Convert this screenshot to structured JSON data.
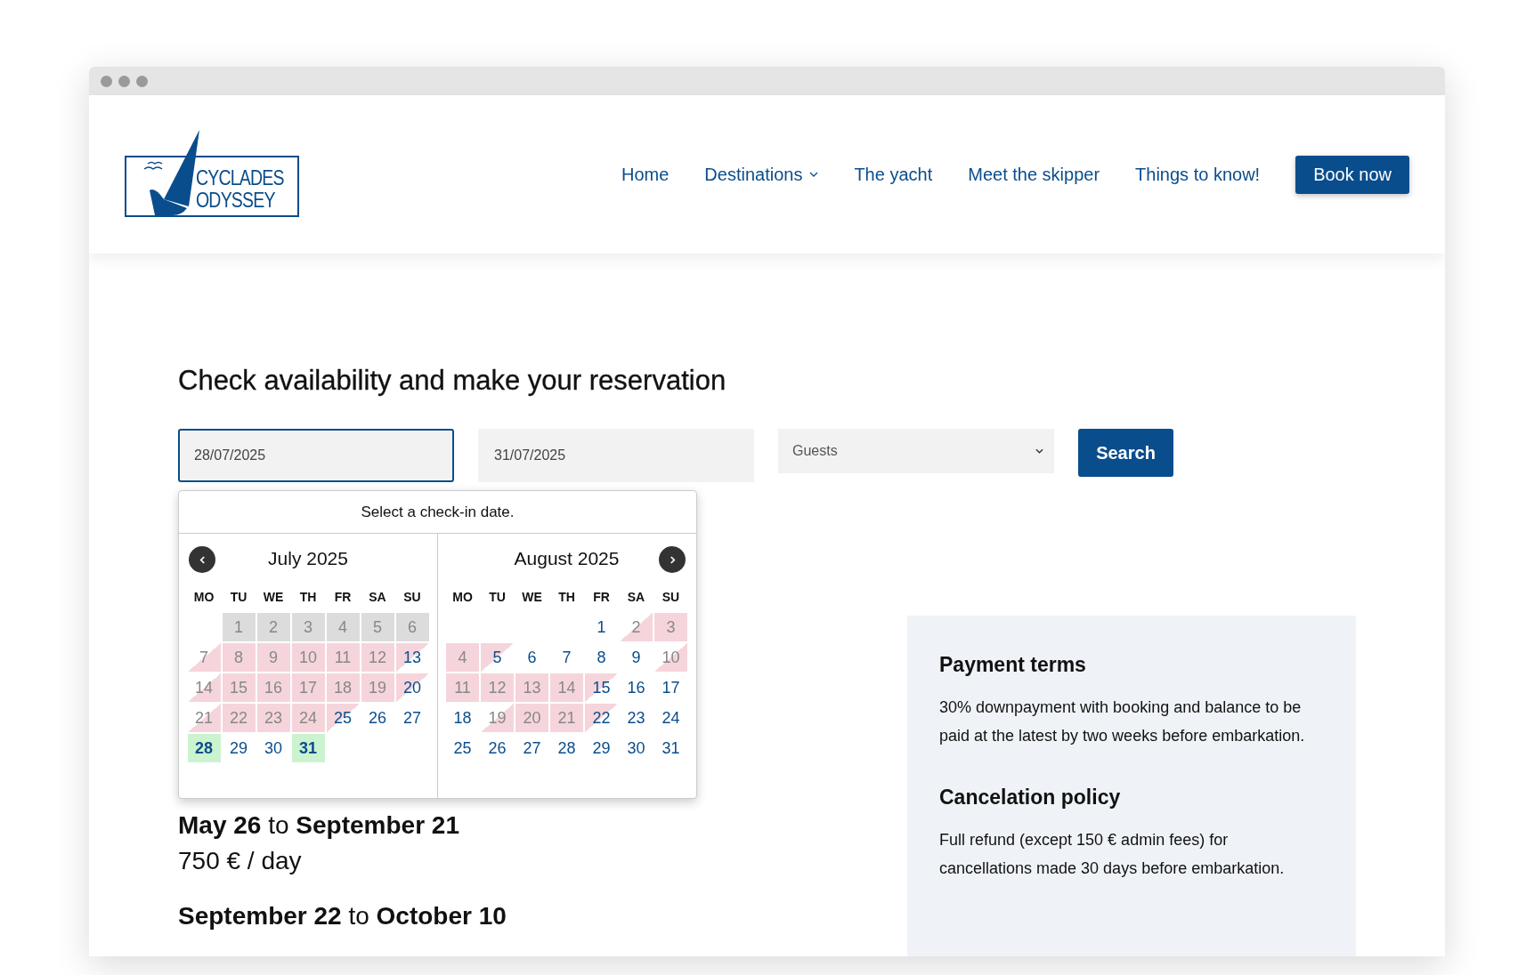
{
  "logo": {
    "line_1": "CYCLADES",
    "line_2": "ODYSSEY"
  },
  "nav": [
    {
      "label": "Home",
      "dropdown": false
    },
    {
      "label": "Destinations",
      "dropdown": true
    },
    {
      "label": "The yacht",
      "dropdown": false
    },
    {
      "label": "Meet the skipper",
      "dropdown": false
    },
    {
      "label": "Things to know!",
      "dropdown": false
    }
  ],
  "book_button": "Book now",
  "heading": "Check availability and make your reservation",
  "checkin": {
    "value": "28/07/2025",
    "focused": true
  },
  "checkout": {
    "value": "31/07/2025",
    "focused": false
  },
  "guests": {
    "placeholder": "Guests"
  },
  "search_button": "Search",
  "datepicker": {
    "prompt": "Select a check-in date.",
    "months": [
      {
        "title": "July 2025",
        "weekdays": [
          "MO",
          "TU",
          "WE",
          "TH",
          "FR",
          "SA",
          "SU"
        ],
        "days": [
          {
            "kind": "empty"
          },
          {
            "day": "1",
            "kind": "past"
          },
          {
            "day": "2",
            "kind": "past"
          },
          {
            "day": "3",
            "kind": "past"
          },
          {
            "day": "4",
            "kind": "past"
          },
          {
            "day": "5",
            "kind": "past"
          },
          {
            "day": "6",
            "kind": "past"
          },
          {
            "day": "7",
            "kind": "pm"
          },
          {
            "day": "8",
            "kind": "booked"
          },
          {
            "day": "9",
            "kind": "booked"
          },
          {
            "day": "10",
            "kind": "booked"
          },
          {
            "day": "11",
            "kind": "booked"
          },
          {
            "day": "12",
            "kind": "booked"
          },
          {
            "day": "13",
            "kind": "am"
          },
          {
            "day": "14",
            "kind": "pm"
          },
          {
            "day": "15",
            "kind": "booked"
          },
          {
            "day": "16",
            "kind": "booked"
          },
          {
            "day": "17",
            "kind": "booked"
          },
          {
            "day": "18",
            "kind": "booked"
          },
          {
            "day": "19",
            "kind": "booked"
          },
          {
            "day": "20",
            "kind": "am"
          },
          {
            "day": "21",
            "kind": "pm"
          },
          {
            "day": "22",
            "kind": "booked"
          },
          {
            "day": "23",
            "kind": "booked"
          },
          {
            "day": "24",
            "kind": "booked"
          },
          {
            "day": "25",
            "kind": "am"
          },
          {
            "day": "26",
            "kind": "free"
          },
          {
            "day": "27",
            "kind": "free"
          },
          {
            "day": "28",
            "kind": "selected"
          },
          {
            "day": "29",
            "kind": "free"
          },
          {
            "day": "30",
            "kind": "free"
          },
          {
            "day": "31",
            "kind": "selected"
          }
        ]
      },
      {
        "title": "August 2025",
        "weekdays": [
          "MO",
          "TU",
          "WE",
          "TH",
          "FR",
          "SA",
          "SU"
        ],
        "days": [
          {
            "kind": "empty"
          },
          {
            "kind": "empty"
          },
          {
            "kind": "empty"
          },
          {
            "kind": "empty"
          },
          {
            "day": "1",
            "kind": "free"
          },
          {
            "day": "2",
            "kind": "pm"
          },
          {
            "day": "3",
            "kind": "booked"
          },
          {
            "day": "4",
            "kind": "booked"
          },
          {
            "day": "5",
            "kind": "am"
          },
          {
            "day": "6",
            "kind": "free"
          },
          {
            "day": "7",
            "kind": "free"
          },
          {
            "day": "8",
            "kind": "free"
          },
          {
            "day": "9",
            "kind": "free"
          },
          {
            "day": "10",
            "kind": "pm"
          },
          {
            "day": "11",
            "kind": "booked"
          },
          {
            "day": "12",
            "kind": "booked"
          },
          {
            "day": "13",
            "kind": "booked"
          },
          {
            "day": "14",
            "kind": "booked"
          },
          {
            "day": "15",
            "kind": "am"
          },
          {
            "day": "16",
            "kind": "free"
          },
          {
            "day": "17",
            "kind": "free"
          },
          {
            "day": "18",
            "kind": "free"
          },
          {
            "day": "19",
            "kind": "pm"
          },
          {
            "day": "20",
            "kind": "booked"
          },
          {
            "day": "21",
            "kind": "booked"
          },
          {
            "day": "22",
            "kind": "am"
          },
          {
            "day": "23",
            "kind": "free"
          },
          {
            "day": "24",
            "kind": "free"
          },
          {
            "day": "25",
            "kind": "free"
          },
          {
            "day": "26",
            "kind": "free"
          },
          {
            "day": "27",
            "kind": "free"
          },
          {
            "day": "28",
            "kind": "free"
          },
          {
            "day": "29",
            "kind": "free"
          },
          {
            "day": "30",
            "kind": "free"
          },
          {
            "day": "31",
            "kind": "free"
          }
        ]
      }
    ]
  },
  "seasons": [
    {
      "period": "**May 26** to **September 21**",
      "price": "750 € / day"
    },
    {
      "period": "**September 22** to **October 10**"
    }
  ],
  "info": [
    {
      "title": "Payment terms",
      "text": "30% downpayment with booking and balance to be paid at the latest by two weeks before embarkation."
    },
    {
      "title": "Cancelation policy",
      "text": "Full refund (except 150 € admin fees) for cancellations made 30 days before embarkation."
    }
  ]
}
